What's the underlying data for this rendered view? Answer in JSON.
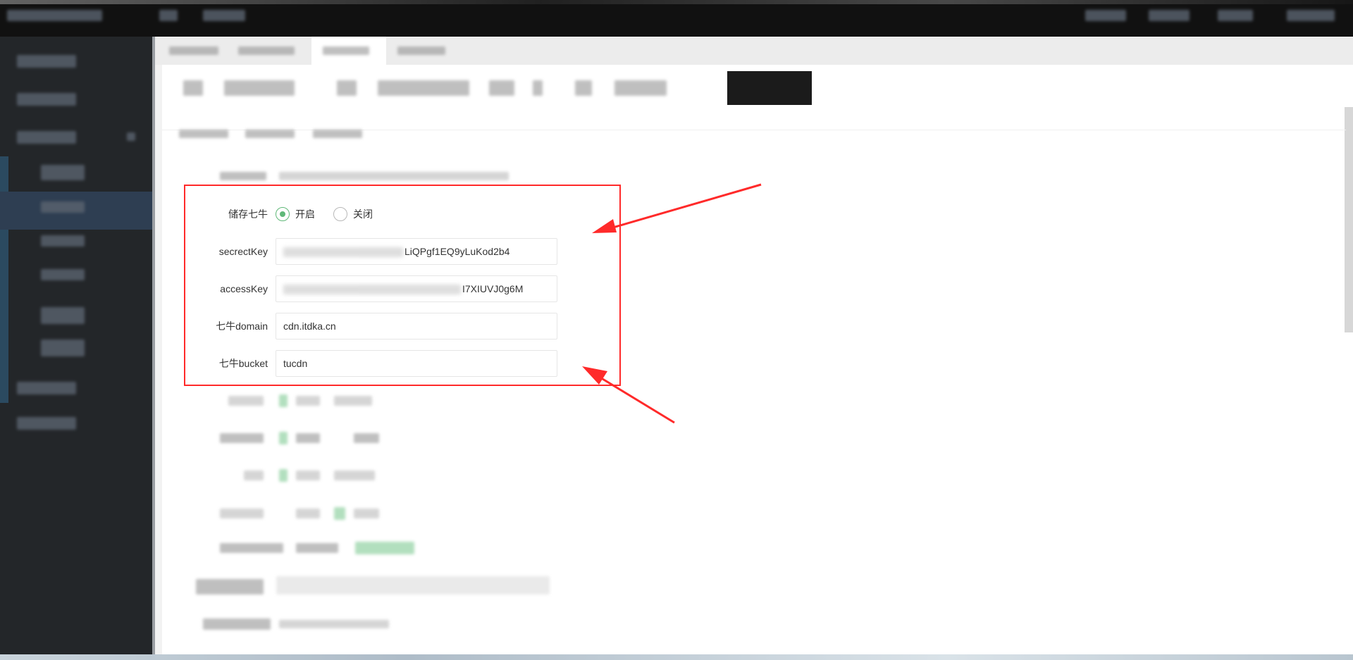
{
  "form": {
    "storage_label": "储存七牛",
    "storage_options": [
      {
        "label": "开启",
        "checked": true
      },
      {
        "label": "关闭",
        "checked": false
      }
    ],
    "secret_key_label": "secrectKey",
    "secret_key_value": "LiQPgf1EQ9yLuKod2b4",
    "access_key_label": "accessKey",
    "access_key_value": "I7XIUVJ0g6M",
    "domain_label": "七牛domain",
    "domain_value": "cdn.itdka.cn",
    "bucket_label": "七牛bucket",
    "bucket_value": "tucdn"
  },
  "colors": {
    "highlight": "#ff2a2a",
    "radio_accent": "#5fb878",
    "sidebar_bg": "#232629",
    "topbar_bg": "#111111"
  }
}
